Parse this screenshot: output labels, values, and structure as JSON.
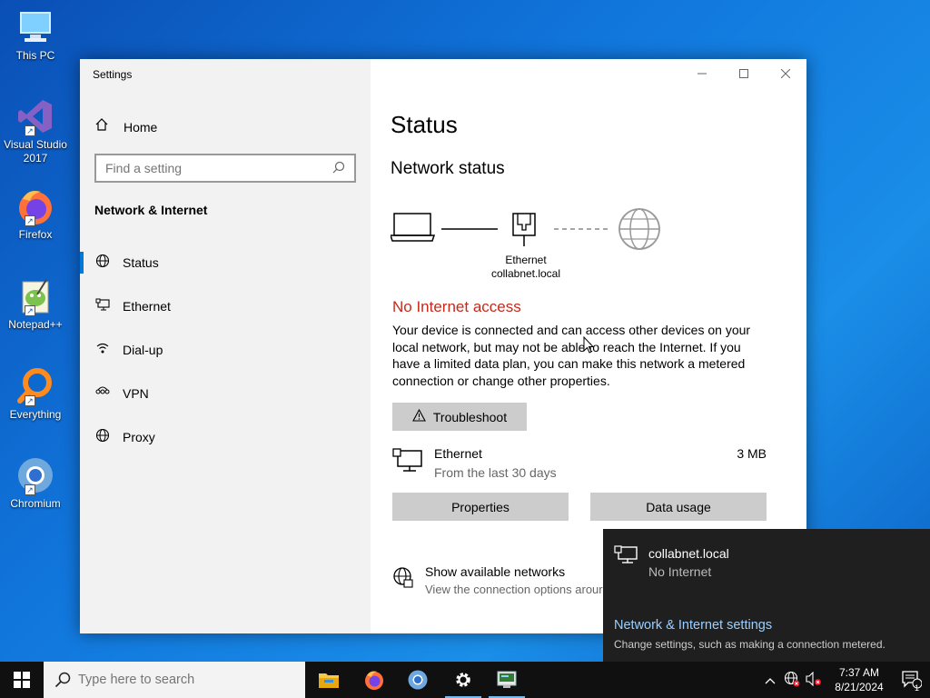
{
  "desktop": {
    "icons": [
      {
        "label": "This PC",
        "icon": "this-pc-icon"
      },
      {
        "label": "Visual Studio 2017",
        "icon": "visual-studio-icon"
      },
      {
        "label": "Firefox",
        "icon": "firefox-icon"
      },
      {
        "label": "Notepad++",
        "icon": "notepadpp-icon"
      },
      {
        "label": "Everything",
        "icon": "everything-icon"
      },
      {
        "label": "Chromium",
        "icon": "chromium-icon"
      }
    ]
  },
  "window": {
    "title": "Settings",
    "sidebar": {
      "home_label": "Home",
      "search_placeholder": "Find a setting",
      "section_title": "Network & Internet",
      "items": [
        {
          "label": "Status",
          "icon": "status-globe-icon",
          "active": true
        },
        {
          "label": "Ethernet",
          "icon": "ethernet-icon",
          "active": false
        },
        {
          "label": "Dial-up",
          "icon": "dialup-icon",
          "active": false
        },
        {
          "label": "VPN",
          "icon": "vpn-icon",
          "active": false
        },
        {
          "label": "Proxy",
          "icon": "proxy-globe-icon",
          "active": false
        }
      ]
    },
    "main": {
      "heading": "Status",
      "subheading": "Network status",
      "diagram": {
        "adapter_name": "Ethernet",
        "network_name": "collabnet.local"
      },
      "connection_status": "No Internet access",
      "description": "Your device is connected and can access other devices on your local network, but may not be able to reach the Internet. If you have a limited data plan, you can make this network a metered connection or change other properties.",
      "troubleshoot_label": "Troubleshoot",
      "adapter": {
        "name": "Ethernet",
        "period": "From the last 30 days",
        "usage": "3 MB"
      },
      "properties_label": "Properties",
      "data_usage_label": "Data usage",
      "show_networks": {
        "title": "Show available networks",
        "subtitle": "View the connection options arour"
      }
    }
  },
  "flyout": {
    "network_name": "collabnet.local",
    "network_status": "No Internet",
    "settings_link": "Network & Internet settings",
    "settings_sub": "Change settings, such as making a connection metered."
  },
  "taskbar": {
    "search_placeholder": "Type here to search",
    "apps": [
      "file-explorer-icon",
      "firefox-icon",
      "chromium-icon",
      "settings-gear-icon",
      "network-app-icon"
    ],
    "clock": {
      "time": "7:37 AM",
      "date": "8/21/2024"
    },
    "notification_count": "1"
  },
  "colors": {
    "accent": "#0078d7",
    "error": "#c42b1c",
    "flyout_bg": "#1f1f1f",
    "link": "#9ccfff"
  }
}
